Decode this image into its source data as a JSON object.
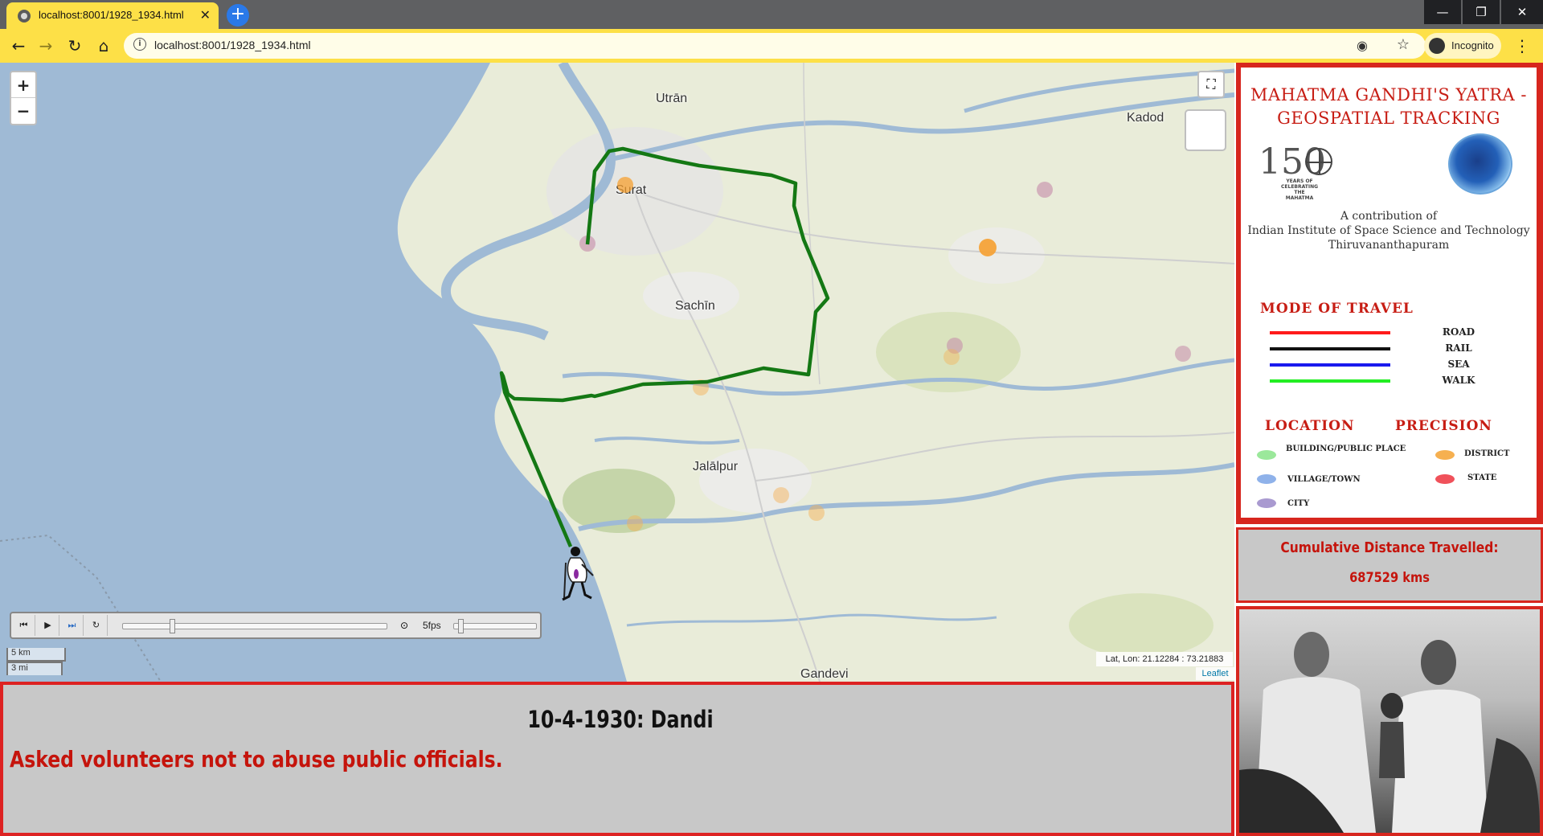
{
  "browser": {
    "tab_title": "localhost:8001/1928_1934.html",
    "tab_close": "✕",
    "new_tab": "+",
    "url": "localhost:8001/1928_1934.html",
    "profile_label": "Incognito",
    "window_minimize": "—",
    "window_restore": "❐",
    "window_close": "✕"
  },
  "map": {
    "zoom_in": "+",
    "zoom_out": "−",
    "fullscreen_icon": "⛶",
    "place_labels": [
      "Utrān",
      "Kadod",
      "Surat",
      "Sachīn",
      "Jalālpur",
      "Gandevi"
    ],
    "player": {
      "rewind": "⏮",
      "play": "▶",
      "fast_forward": "⏭",
      "reload": "↻",
      "clock": "⊙",
      "speed_label": "5fps",
      "time_position": 0.18,
      "speed_position": 0.05
    },
    "scale": {
      "metric": "5 km",
      "imperial": "3 mi"
    },
    "cursor_coords": "Lat, Lon: 21.12284 : 73.21883",
    "attribution": "Leaflet",
    "route_color": "#147814"
  },
  "event": {
    "date_place": "10-4-1930: Dandi",
    "description": "Asked volunteers not to abuse public officials."
  },
  "sidebar": {
    "title_line1": "MAHATMA GANDHI'S YATRA -",
    "title_line2": "GEOSPATIAL TRACKING",
    "logo_150_text": "YEARS OF CELEBRATING THE MAHATMA",
    "contribution_line1": "A contribution of",
    "contribution_line2": "Indian Institute of Space Science and Technology",
    "contribution_line3": "Thiruvananthapuram",
    "mode_heading": "MODE OF TRAVEL",
    "modes": [
      {
        "label": "ROAD",
        "color": "#ff1a1a"
      },
      {
        "label": "RAIL",
        "color": "#111111"
      },
      {
        "label": "SEA",
        "color": "#1a1aee"
      },
      {
        "label": "WALK",
        "color": "#22ee22"
      }
    ],
    "precision_heading_1": "LOCATION",
    "precision_heading_2": "PRECISION",
    "precision": [
      {
        "label": "BUILDING/PUBLIC PLACE",
        "color": "#9be89b"
      },
      {
        "label": "DISTRICT",
        "color": "#f6b050"
      },
      {
        "label": "VILLAGE/TOWN",
        "color": "#8fb2ea"
      },
      {
        "label": "STATE",
        "color": "#f0515a"
      },
      {
        "label": "CITY",
        "color": "#a99ad0"
      }
    ]
  },
  "distance": {
    "label": "Cumulative Distance Travelled:",
    "value": "687529 kms"
  }
}
